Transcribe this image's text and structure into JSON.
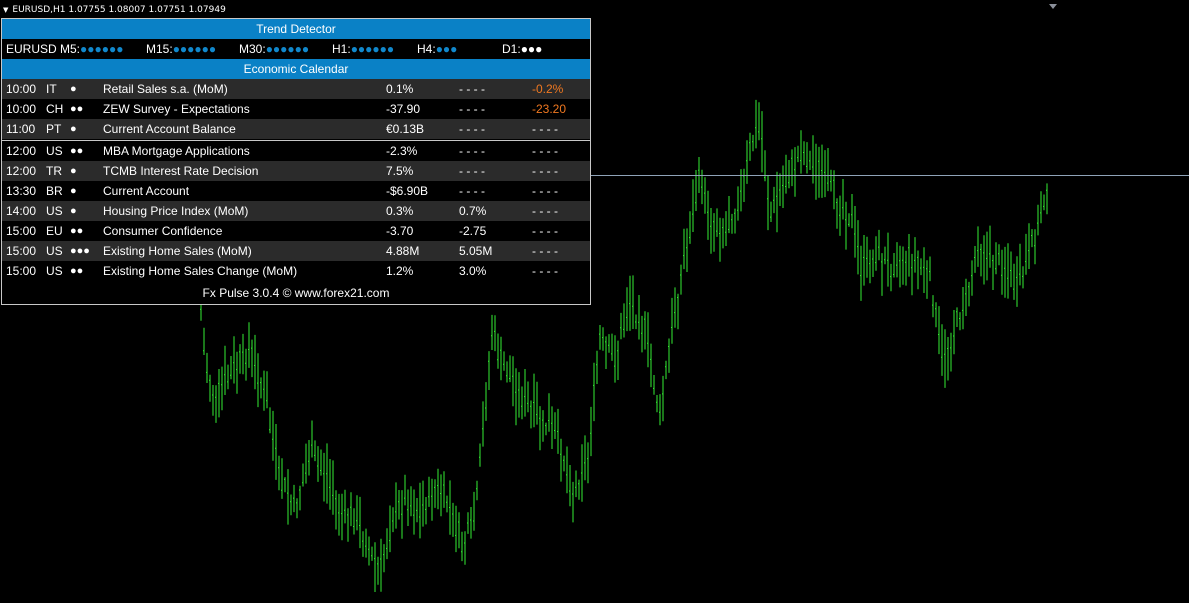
{
  "symbol_line": "EURUSD,H1  1.07755 1.08007 1.07751 1.07949",
  "chart": {
    "candle_color": "#33ee33",
    "hline_color": "#8fa3b8",
    "hline_level": 1.079
  },
  "trend": {
    "title": "Trend Detector",
    "symbol": "EURUSD",
    "timeframes": [
      {
        "label": "M5:",
        "dots": "●●●●●●",
        "color": "#1188cc"
      },
      {
        "label": "M15:",
        "dots": "●●●●●●",
        "color": "#1188cc"
      },
      {
        "label": "M30:",
        "dots": "●●●●●●",
        "color": "#1188cc"
      },
      {
        "label": "H1:",
        "dots": "●●●●●●",
        "color": "#1188cc"
      },
      {
        "label": "H4:",
        "dots": "●●●",
        "color": "#1188cc"
      },
      {
        "label": "D1:",
        "dots": "●●●",
        "color": "#ffffff"
      }
    ]
  },
  "calendar": {
    "title": "Economic Calendar",
    "events": [
      {
        "time": "10:00",
        "cc": "IT",
        "imp": "●",
        "name": "Retail Sales s.a. (MoM)",
        "actual": "0.1%",
        "forecast": "- - - -",
        "previous": "-0.2%",
        "prev_color": "orange"
      },
      {
        "time": "10:00",
        "cc": "CH",
        "imp": "●●",
        "name": "ZEW Survey - Expectations",
        "actual": "-37.90",
        "forecast": "- - - -",
        "previous": "-23.20",
        "prev_color": "orange"
      },
      {
        "time": "11:00",
        "cc": "PT",
        "imp": "●",
        "name": "Current Account Balance",
        "actual": "€0.13B",
        "forecast": "- - - -",
        "previous": "- - - -",
        "prev_color": "white"
      },
      {
        "time": "12:00",
        "cc": "US",
        "imp": "●●",
        "name": "MBA Mortgage Applications",
        "actual": "-2.3%",
        "forecast": "- - - -",
        "previous": "- - - -",
        "prev_color": "white"
      },
      {
        "time": "12:00",
        "cc": "TR",
        "imp": "●",
        "name": "TCMB Interest Rate Decision",
        "actual": "7.5%",
        "forecast": "- - - -",
        "previous": "- - - -",
        "prev_color": "white"
      },
      {
        "time": "13:30",
        "cc": "BR",
        "imp": "●",
        "name": "Current Account",
        "actual": "-$6.90B",
        "forecast": "- - - -",
        "previous": "- - - -",
        "prev_color": "white"
      },
      {
        "time": "14:00",
        "cc": "US",
        "imp": "●",
        "name": "Housing Price Index (MoM)",
        "actual": "0.3%",
        "forecast": "0.7%",
        "previous": "- - - -",
        "prev_color": "white"
      },
      {
        "time": "15:00",
        "cc": "EU",
        "imp": "●●",
        "name": "Consumer Confidence",
        "actual": "-3.70",
        "forecast": "-2.75",
        "previous": "- - - -",
        "prev_color": "white"
      },
      {
        "time": "15:00",
        "cc": "US",
        "imp": "●●●",
        "name": "Existing Home Sales (MoM)",
        "actual": "4.88M",
        "forecast": "5.05M",
        "previous": "- - - -",
        "prev_color": "white"
      },
      {
        "time": "15:00",
        "cc": "US",
        "imp": "●●",
        "name": "Existing Home Sales Change (MoM)",
        "actual": "1.2%",
        "forecast": "3.0%",
        "previous": "- - - -",
        "prev_color": "white"
      }
    ]
  },
  "footer": "Fx Pulse 3.0.4 © www.forex21.com"
}
